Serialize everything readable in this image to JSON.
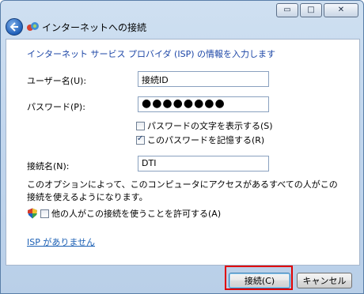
{
  "window": {
    "title": "インターネットへの接続"
  },
  "caption": {
    "minimize": "▭",
    "maximize": "□",
    "close": "✕"
  },
  "form": {
    "heading": "インターネット サービス プロバイダ (ISP) の情報を入力します",
    "username_label": "ユーザー名(U):",
    "username_value": "接続ID",
    "password_label": "パスワード(P):",
    "password_value": "●●●●●●●●",
    "show_password_label": "パスワードの文字を表示する(S)",
    "show_password_checked": false,
    "remember_password_label": "このパスワードを記憶する(R)",
    "remember_password_checked": true,
    "connection_name_label": "接続名(N):",
    "connection_name_value": "DTI",
    "option_text": "このオプションによって、このコンピュータにアクセスがあるすべての人がこの接続を使えるようになります。",
    "allow_others_label": "他の人がこの接続を使うことを許可する(A)",
    "allow_others_checked": false,
    "no_isp_link": "ISP がありません"
  },
  "buttons": {
    "connect": "接続(C)",
    "cancel": "キャンセル"
  },
  "colors": {
    "highlight": "#e00000",
    "heading": "#1b45a6",
    "link": "#1a5fb4"
  }
}
